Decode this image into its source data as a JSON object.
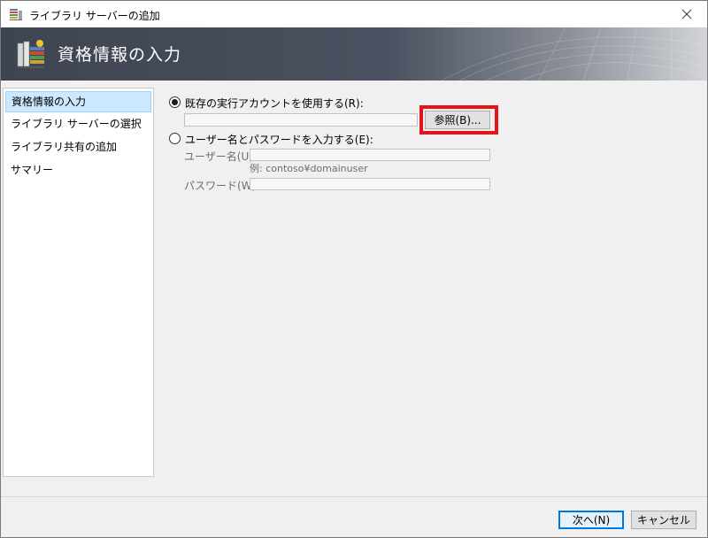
{
  "window": {
    "title": "ライブラリ サーバーの追加"
  },
  "banner": {
    "title": "資格情報の入力"
  },
  "sidebar": {
    "items": [
      {
        "label": "資格情報の入力",
        "active": true
      },
      {
        "label": "ライブラリ サーバーの選択",
        "active": false
      },
      {
        "label": "ライブラリ共有の追加",
        "active": false
      },
      {
        "label": "サマリー",
        "active": false
      }
    ]
  },
  "credentials": {
    "existing_account_label": "既存の実行アカウントを使用する(R):",
    "existing_account_value": "",
    "browse_label": "参照(B)...",
    "manual_label": "ユーザー名とパスワードを入力する(E):",
    "username_label": "ユーザー名(U):",
    "username_value": "",
    "username_hint": "例: contoso¥domainuser",
    "password_label": "パスワード(W):",
    "password_value": ""
  },
  "footer": {
    "next_label": "次へ(N)",
    "cancel_label": "キャンセル"
  },
  "colors": {
    "highlight": "#e4141b",
    "active_nav": "#cce8ff",
    "primary_border": "#0078d7"
  }
}
